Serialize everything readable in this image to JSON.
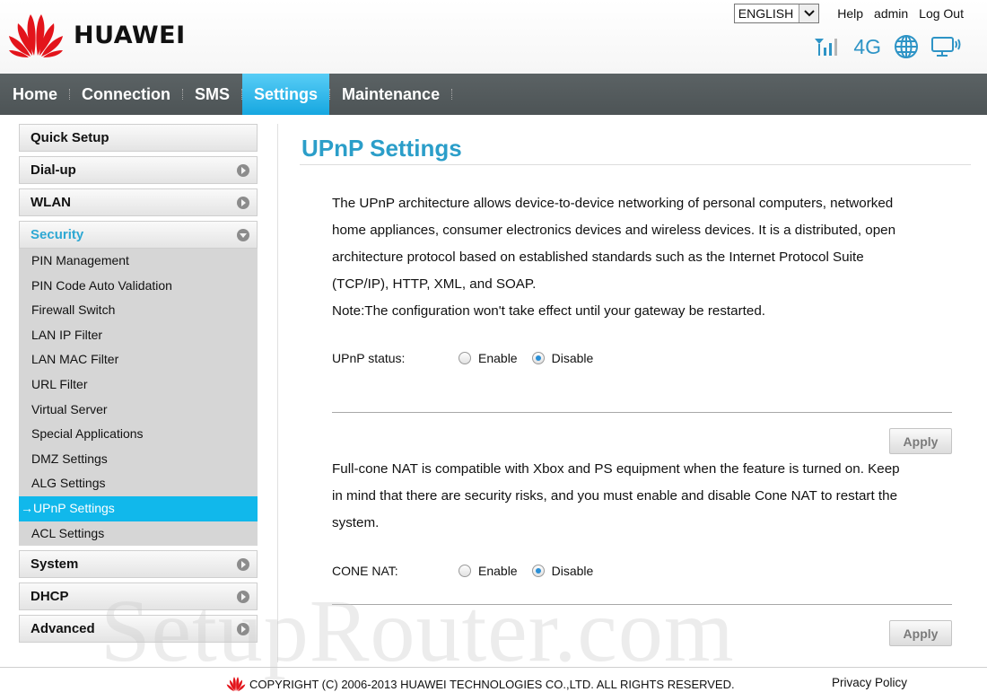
{
  "brand": {
    "name": "HUAWEI"
  },
  "top_bar": {
    "language": "ENGLISH",
    "links": [
      "Help",
      "admin",
      "Log Out"
    ],
    "network_type": "4G",
    "icons": [
      "signal-strength-icon",
      "globe-icon",
      "monitor-wifi-icon"
    ]
  },
  "nav": {
    "items": [
      "Home",
      "Connection",
      "SMS",
      "Settings",
      "Maintenance"
    ],
    "active": "Settings"
  },
  "sidebar": {
    "sections": [
      {
        "label": "Quick Setup"
      },
      {
        "label": "Dial-up"
      },
      {
        "label": "WLAN"
      },
      {
        "label": "Security"
      },
      {
        "label": "System"
      },
      {
        "label": "DHCP"
      },
      {
        "label": "Advanced"
      }
    ],
    "security_items": [
      "PIN Management",
      "PIN Code Auto Validation",
      "Firewall Switch",
      "LAN IP Filter",
      "LAN MAC Filter",
      "URL Filter",
      "Virtual Server",
      "Special Applications",
      "DMZ Settings",
      "ALG Settings",
      "→UPnP Settings",
      "ACL Settings"
    ],
    "active_item": "UPnP Settings"
  },
  "main": {
    "title": "UPnP Settings",
    "upnp_description": [
      "The UPnP architecture allows device-to-device networking of personal computers, networked",
      "home appliances, consumer electronics devices and wireless devices. It is a distributed, open",
      "architecture protocol based on established standards such as the Internet Protocol Suite",
      "(TCP/IP), HTTP, XML, and SOAP.",
      "Note:The configuration won't take effect until your gateway be restarted."
    ],
    "upnp_status": {
      "label": "UPnP status:",
      "enable": "Enable",
      "disable": "Disable",
      "value": "Disable"
    },
    "apply_label": "Apply",
    "cone_description": [
      "Full-cone NAT is compatible with Xbox and PS equipment when the feature is turned on. Keep",
      "in mind that there are security risks, and you must enable and disable Cone NAT to restart the",
      "system."
    ],
    "cone_nat": {
      "label": "CONE NAT:",
      "enable": "Enable",
      "disable": "Disable",
      "value": "Disable"
    }
  },
  "watermark": "SetupRouter.com",
  "footer": {
    "copyright": "COPYRIGHT (C) 2006-2013 HUAWEI TECHNOLOGIES CO.,LTD. ALL RIGHTS RESERVED.",
    "privacy": "Privacy Policy"
  },
  "colors": {
    "accent": "#2b9ec9",
    "nav_active": "#16a7e0",
    "nav_bg": "#565d5f",
    "brand_red": "#e3141b"
  }
}
